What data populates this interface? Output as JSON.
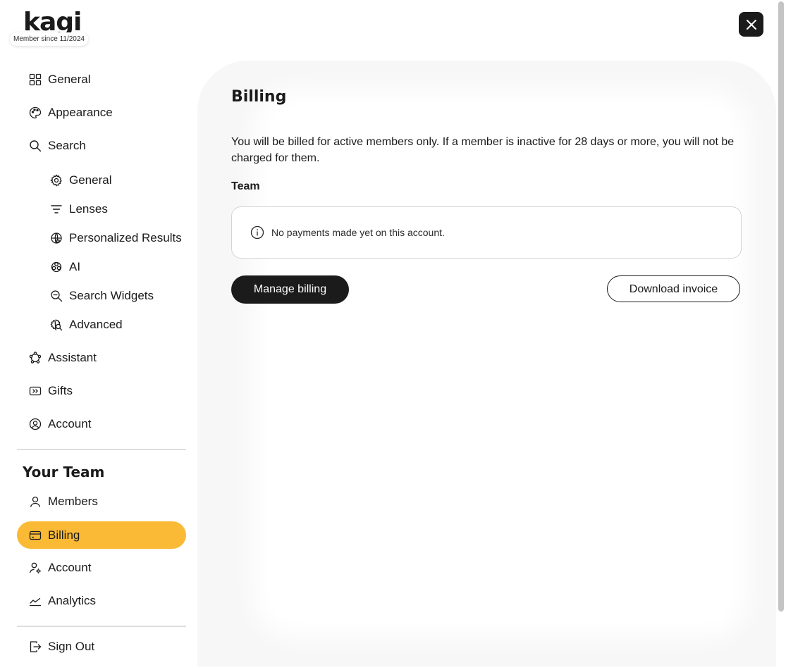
{
  "brand": {
    "logo_text": "kagi",
    "member_since": "Member since 11/2024"
  },
  "close_button": {
    "icon": "close-icon"
  },
  "sidebar": {
    "items": [
      {
        "label": "General",
        "icon": "grid-icon"
      },
      {
        "label": "Appearance",
        "icon": "palette-icon"
      },
      {
        "label": "Search",
        "icon": "search-icon"
      },
      {
        "label": "General",
        "icon": "gear-icon"
      },
      {
        "label": "Lenses",
        "icon": "filter-icon"
      },
      {
        "label": "Personalized Results",
        "icon": "globe-heart-icon"
      },
      {
        "label": "AI",
        "icon": "brain-icon"
      },
      {
        "label": "Search Widgets",
        "icon": "search-widget-icon"
      },
      {
        "label": "Advanced",
        "icon": "gear-search-icon"
      },
      {
        "label": "Assistant",
        "icon": "assistant-icon"
      },
      {
        "label": "Gifts",
        "icon": "gift-card-icon"
      },
      {
        "label": "Account",
        "icon": "user-circle-icon"
      }
    ],
    "team_heading": "Your Team",
    "team_items": [
      {
        "label": "Members",
        "icon": "person-icon"
      },
      {
        "label": "Billing",
        "icon": "credit-card-icon",
        "active": true
      },
      {
        "label": "Account",
        "icon": "person-gear-icon"
      },
      {
        "label": "Analytics",
        "icon": "chart-line-icon"
      }
    ],
    "sign_out": {
      "label": "Sign Out",
      "icon": "sign-out-icon"
    }
  },
  "main": {
    "title": "Billing",
    "description": "You will be billed for active members only. If a member is inactive for 28 days or more, you will not be charged for them.",
    "subtitle": "Team",
    "info_message": "No payments made yet on this account.",
    "manage_billing_label": "Manage billing",
    "download_invoice_label": "Download invoice"
  },
  "colors": {
    "accent": "#fbba35",
    "dark": "#1b1b1b",
    "panel_bg": "#f7f7f7"
  }
}
